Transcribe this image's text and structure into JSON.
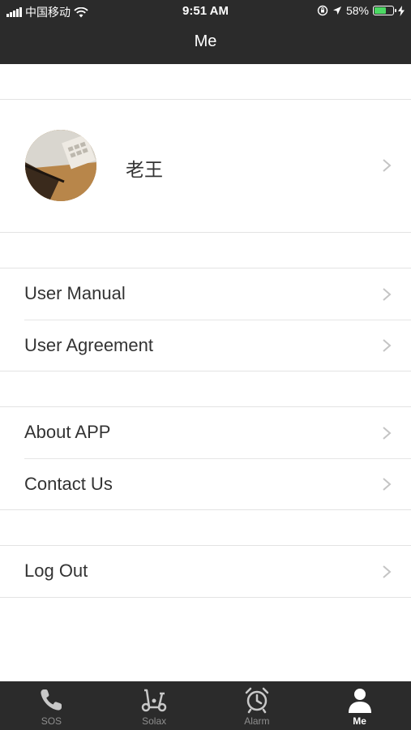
{
  "status_bar": {
    "carrier": "中国移动",
    "time": "9:51 AM",
    "battery_percent": "58%",
    "battery_level": 0.58
  },
  "nav": {
    "title": "Me"
  },
  "profile": {
    "name": "老王"
  },
  "menu": {
    "user_manual": "User Manual",
    "user_agreement": "User Agreement",
    "about_app": "About APP",
    "contact_us": "Contact Us",
    "log_out": "Log Out"
  },
  "tabs": [
    {
      "label": "SOS",
      "icon": "phone-icon"
    },
    {
      "label": "Solax",
      "icon": "scooter-icon"
    },
    {
      "label": "Alarm",
      "icon": "alarm-clock-icon"
    },
    {
      "label": "Me",
      "icon": "person-icon",
      "active": true
    }
  ],
  "colors": {
    "bar_background": "#2b2b2b",
    "battery_fill": "#4cd964",
    "inactive_tab": "#8e8e8e",
    "active_tab": "#ffffff"
  }
}
